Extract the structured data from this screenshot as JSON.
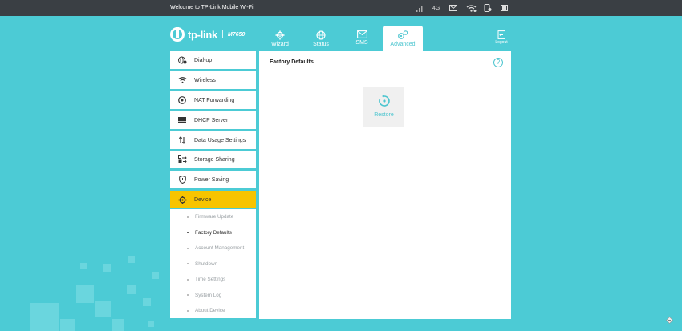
{
  "topbar": {
    "welcome": "Welcome to TP-Link Mobile Wi-Fi",
    "network_type": "4G",
    "icons": [
      "signal-icon",
      "mail-icon",
      "wifi-icon",
      "device-icon",
      "battery-icon"
    ]
  },
  "header": {
    "brand": "tp-link",
    "model": "M7650",
    "tabs": [
      {
        "label": "Wizard",
        "icon": "gear-icon"
      },
      {
        "label": "Status",
        "icon": "globe-icon"
      },
      {
        "label": "SMS",
        "icon": "mail-icon"
      },
      {
        "label": "Advanced",
        "icon": "gears-icon",
        "active": true
      }
    ],
    "logout": "Logout"
  },
  "sidebar": {
    "items": [
      {
        "label": "Dial-up",
        "icon": "globe-gear-icon"
      },
      {
        "label": "Wireless",
        "icon": "wifi-icon"
      },
      {
        "label": "NAT Forwarding",
        "icon": "nat-icon"
      },
      {
        "label": "DHCP Server",
        "icon": "server-icon"
      },
      {
        "label": "Data Usage Settings",
        "icon": "arrows-icon"
      },
      {
        "label": "Storage Sharing",
        "icon": "share-icon"
      },
      {
        "label": "Power Saving",
        "icon": "shield-icon"
      },
      {
        "label": "Device",
        "icon": "gear-icon",
        "active": true
      }
    ],
    "sub_items": [
      {
        "label": "Firmware Update"
      },
      {
        "label": "Factory Defaults",
        "current": true
      },
      {
        "label": "Account Management"
      },
      {
        "label": "Shutdown"
      },
      {
        "label": "Time Settings"
      },
      {
        "label": "System Log"
      },
      {
        "label": "About Device"
      }
    ]
  },
  "main": {
    "title": "Factory Defaults",
    "help": "?",
    "restore_label": "Restore"
  },
  "colors": {
    "background": "#4ccbd5",
    "accent": "#4cc5cf",
    "active_menu": "#f7c400",
    "topbar": "#3a3f44"
  }
}
